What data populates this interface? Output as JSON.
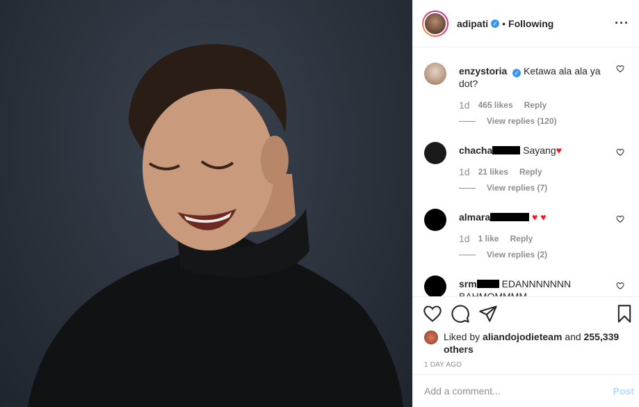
{
  "header": {
    "username": "adipati",
    "separator": "•",
    "follow_status": "Following",
    "more": "···"
  },
  "comments": [
    {
      "username": "enzystoria",
      "verified": true,
      "text": "Ketawa ala ala ya dot?",
      "time": "1d",
      "likes": "465 likes",
      "reply": "Reply",
      "view_replies": "View replies (120)"
    },
    {
      "username": "chacha",
      "text": "Sayang",
      "time": "1d",
      "likes": "21 likes",
      "reply": "Reply",
      "view_replies": "View replies (7)"
    },
    {
      "username": "almara",
      "text": "",
      "time": "1d",
      "likes": "1 like",
      "reply": "Reply",
      "view_replies": "View replies (2)"
    },
    {
      "username": "srm",
      "text": "EDANNNNNNN",
      "text2": "BAHMOMMMM"
    }
  ],
  "likes": {
    "prefix": "Liked by",
    "user": "aliandojodieteam",
    "and": "and",
    "count": "255,339 others"
  },
  "time_ago": "1 DAY AGO",
  "add_comment": {
    "placeholder": "Add a comment...",
    "post_label": "Post"
  },
  "colors": {
    "verified_blue": "#3897f0",
    "muted_text": "#8e8e8e",
    "post_disabled": "#b3dbff",
    "heart_red": "#ed1c24"
  }
}
